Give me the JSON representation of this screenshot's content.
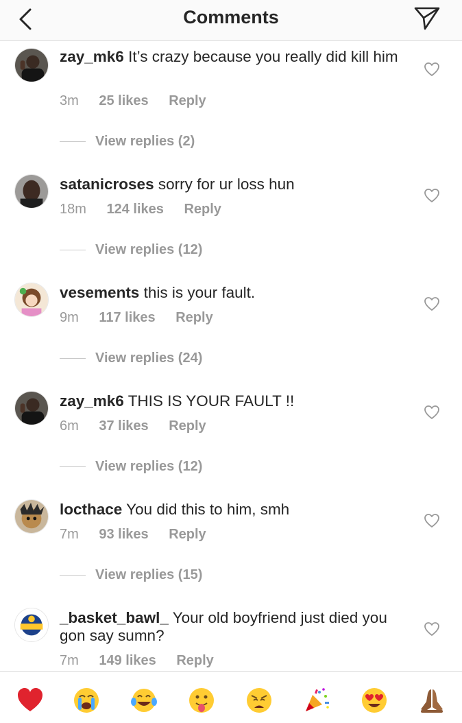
{
  "header": {
    "title": "Comments"
  },
  "comments": [
    {
      "username": "zay_mk6",
      "text": "It’s crazy because you really did kill him",
      "time": "3m",
      "likes": "25 likes",
      "reply": "Reply",
      "view_replies": "View replies (2)"
    },
    {
      "username": "satanicroses",
      "text": "sorry for ur loss hun",
      "time": "18m",
      "likes": "124 likes",
      "reply": "Reply",
      "view_replies": "View replies (12)"
    },
    {
      "username": "vesements",
      "text": "this is your fault.",
      "time": "9m",
      "likes": "117 likes",
      "reply": "Reply",
      "view_replies": "View replies (24)"
    },
    {
      "username": "zay_mk6",
      "text": "THIS IS YOUR FAULT !!",
      "time": "6m",
      "likes": "37 likes",
      "reply": "Reply",
      "view_replies": "View replies (12)"
    },
    {
      "username": "locthace",
      "text": "You did this to him, smh",
      "time": "7m",
      "likes": "93 likes",
      "reply": "Reply",
      "view_replies": "View replies (15)"
    },
    {
      "username": "_basket_bawl_",
      "text": "Your old boyfriend just died you gon say sumn?",
      "time": "7m",
      "likes": "149 likes",
      "reply": "Reply"
    }
  ],
  "emoji_bar": [
    "red-heart",
    "crying-face",
    "tears-of-joy",
    "tongue-face",
    "weary-face",
    "party-popper",
    "heart-eyes",
    "folded-hands"
  ],
  "colors": {
    "text": "#262626",
    "secondary": "#999999",
    "divider": "#dbdbdb",
    "header_bg": "#fafafa"
  }
}
